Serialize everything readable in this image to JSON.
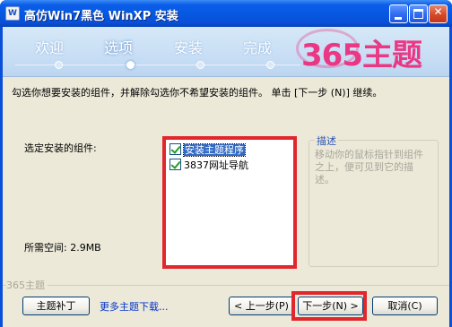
{
  "window": {
    "title": "高仿Win7黑色 WinXP 安装",
    "icon_name": "installer-app-icon",
    "controls": {
      "minimize": "minimize-icon",
      "maximize": "maximize-icon",
      "close": "close-icon"
    }
  },
  "header": {
    "steps": [
      "欢迎",
      "选项",
      "安装",
      "完成"
    ],
    "active_step_index": 1,
    "logo": "365主题"
  },
  "body": {
    "instruction": "勾选你想要安装的组件，并解除勾选你不希望安装的组件。 单击 [下一步 (N)] 继续。",
    "select_label": "选定安装的组件:",
    "space_required": "所需空间: 2.9MB",
    "components": [
      {
        "label": "安装主题程序",
        "checked": true,
        "selected": true
      },
      {
        "label": "3837网址导航",
        "checked": true,
        "selected": false
      }
    ],
    "description": {
      "title": "描述",
      "text": "移动你的鼠标指针到组件之上，便可见到它的描述。"
    }
  },
  "footer": {
    "brand": "365主题",
    "patch_button": "主题补丁",
    "more_link": "更多主题下载...",
    "back_button": "< 上一步(P)",
    "next_button": "下一步(N) >",
    "cancel_button": "取消(C)"
  },
  "colors": {
    "titlebar_blue": "#0a4fd8",
    "dialog_bg": "#ece9d8",
    "highlight_red": "#e2262d",
    "logo_pink": "#ee2a7b",
    "link_blue": "#0033cc",
    "selection_blue": "#316ac5"
  }
}
